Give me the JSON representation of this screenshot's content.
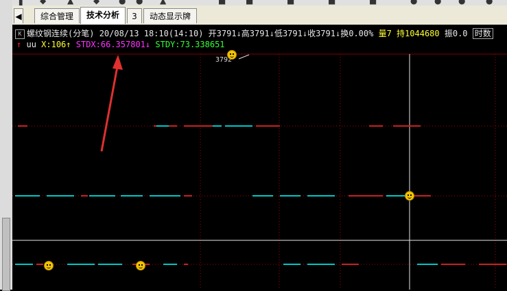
{
  "tabs": [
    {
      "label": "综合管理"
    },
    {
      "label": "技术分析"
    },
    {
      "label": "3"
    },
    {
      "label": "动态显示牌"
    }
  ],
  "info_bar": {
    "k_button": "K",
    "symbol": "螺纹钢连续(分笔)",
    "date": "20/08/13",
    "time": "18:10(14:10)",
    "open": "开3791",
    "high": "高3791",
    "low": "低3791",
    "close": "收3791",
    "turnover_rate": "换0.00%",
    "volume": "量7",
    "open_interest": "持1044680",
    "amplitude": "振0.0",
    "time_sharing": "时数"
  },
  "indicator_line": {
    "name": "uu",
    "x_value": "X:106",
    "stdx": "STDX:66.357801",
    "stdy": "STDY:73.338651"
  },
  "chart": {
    "price_label": "3792"
  },
  "colors": {
    "background": "#000000",
    "grid_red": "#b00000",
    "cyan": "#00c8c8",
    "magenta": "#ff33ff",
    "green": "#33ff33",
    "yellow": "#ffff33",
    "annotation_red": "#e0302f"
  }
}
